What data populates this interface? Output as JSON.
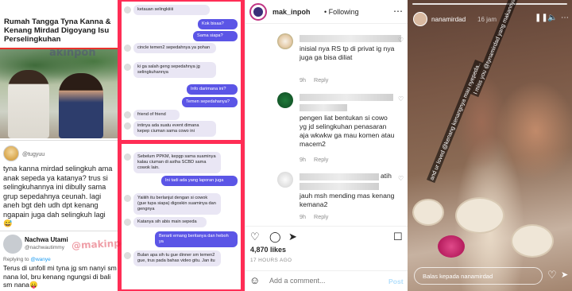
{
  "left_collage": {
    "headline": "Rumah Tangga Tyna Kanna & Kenang Mirdad Digoyang Isu Perselingkuhan",
    "menu_icon": "hamburger-icon",
    "photo_watermark": "akinpoh",
    "tweet1": {
      "handle": "@tugyuu",
      "text": "tyna kanna mirdad selingkuh ama anak sepeda ya katanya? trus si selingkuhannya ini dibully sama grup sepedahnya ceunah. lagi aneh bgt deh udh dpt kenang ngapain juga dah selingkuh lagi 😅"
    },
    "tweet2": {
      "name": "Nachwa Utami",
      "handle": "@nachwautimmy",
      "reply_prefix": "Replying to",
      "reply_handle": "@wanye",
      "text": "Terus di unfoll mi tyna jg sm nanyi sm nana lol, bru kenang ngungsi di bali sm nana😛"
    },
    "watermark": "@makinpoh",
    "chat1": [
      {
        "side": "l",
        "text": "ketauan selingkiiiii"
      },
      {
        "side": "r",
        "text": "Kok bisaa?"
      },
      {
        "side": "r",
        "text": "Sama siapa?"
      },
      {
        "side": "l",
        "text": "cincle temen2 sepedahnya ya pohan"
      },
      {
        "side": "l",
        "text": "ki ga salah geng sepedahnya jg selingkuhannya"
      },
      {
        "side": "r",
        "text": "Info darimana ini?"
      },
      {
        "side": "r",
        "text": "Temen sepedahanya?"
      },
      {
        "side": "l",
        "text": "friend of friend"
      },
      {
        "side": "l",
        "text": "intinya ada suatu event dimana kepep ciuman sama cowo ini"
      }
    ],
    "chat2": [
      {
        "side": "l",
        "text": "Sebelum PPKM, kepgp sama suaminya kalau ciuman di astha SCBD sama cowok lain."
      },
      {
        "side": "r",
        "text": "Ini tadi ada yang laporan juga"
      },
      {
        "side": "l",
        "text": "Yaiiiih itu berlanjut dengan si cowok (gue tupa siapa) digoskin suaminya dan gengnya"
      },
      {
        "side": "l",
        "text": "Katanya sih abis main sepeda"
      },
      {
        "side": "r",
        "text": "Berarti emang beritanya dan heboh ya"
      },
      {
        "side": "l",
        "text": "Bulan apa sih tu gue dinner sm temen2 gue, trus pada bahas video gitu. Jan itu"
      }
    ]
  },
  "instagram": {
    "username": "mak_inpoh",
    "follow_status": "• Following",
    "more_icon": "more-dots-icon",
    "comments": [
      {
        "text": "inisial nya RS tp di privat ig nya juga ga bisa diliat",
        "time": "9h",
        "reply": "Reply"
      },
      {
        "text": "pengen liat bentukan si cowo yg jd selingkuhan penasaran aja wkwkw ga mau komen atau macem2",
        "time": "9h",
        "reply": "Reply"
      },
      {
        "text": "jauh msh mending mas kenang kemana2",
        "time": "9h",
        "reply": "Reply"
      }
    ],
    "comment_partial_word": "atih",
    "likes": "4,870 likes",
    "posted_ago": "17 HOURS AGO",
    "add_comment_placeholder": "Add a comment...",
    "post_label": "Post",
    "icons": [
      "heart-icon",
      "comment-icon",
      "share-icon",
      "bookmark-icon",
      "emoji-icon"
    ]
  },
  "story": {
    "username": "nanamirdad",
    "time": "16 jam",
    "caption1": "I miss you @tynamirdad yang makannya segepok..",
    "caption2": "and ur loved @kenang kenangnya mau nyepeda..",
    "reply_placeholder": "Balas kepada nanamirdad",
    "icons": [
      "pause-icon",
      "mute-icon",
      "more-icon",
      "heart-icon",
      "send-icon"
    ]
  }
}
